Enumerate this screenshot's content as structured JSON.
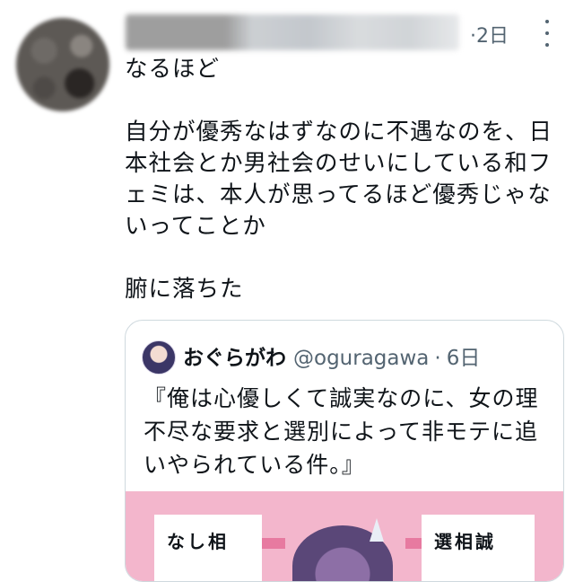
{
  "tweet": {
    "time": "·2日",
    "paragraphs": [
      "なるほど",
      "自分が優秀なはずなのに不遇なのを、日本社会とか男社会のせいにしている和フェミは、本人が思ってるほど優秀じゃないってことか",
      "腑に落ちた"
    ]
  },
  "quote": {
    "name": "おぐらがわ",
    "handle": "@oguragawa",
    "separator": "·",
    "time": "6日",
    "text": "『俺は心優しくて誠実なのに、女の理不尽な要求と選別によって非モテに追いやられている件。』",
    "image": {
      "left_text": "なし相",
      "right_text": "選相誠"
    }
  },
  "icons": [
    "more-vertical-icon"
  ],
  "colors": {
    "text": "#0f1419",
    "secondary": "#536471",
    "border": "#cfd9de",
    "cover_pink": "#f3b6cc"
  }
}
